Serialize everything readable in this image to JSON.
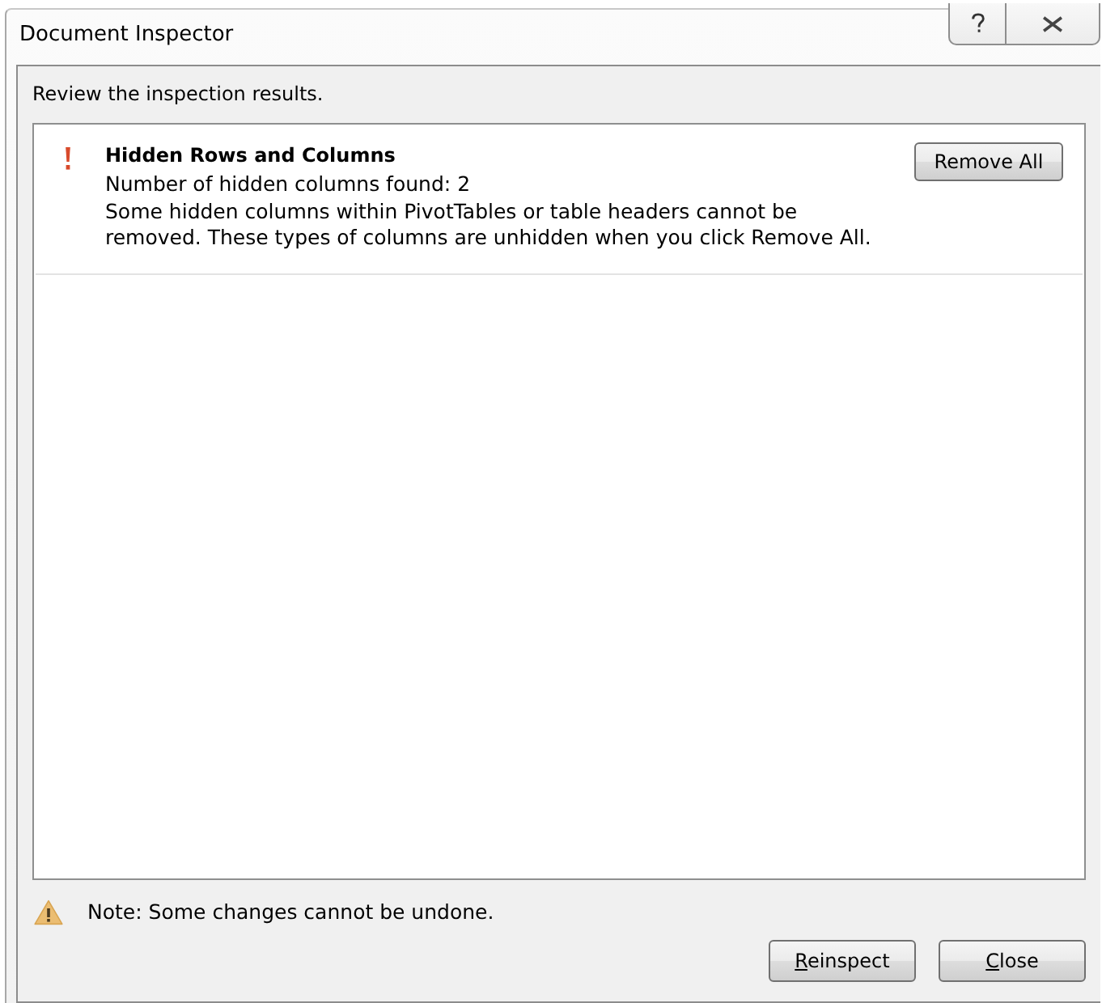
{
  "window": {
    "title": "Document Inspector"
  },
  "title_bar_buttons": [
    {
      "kind": "help"
    },
    {
      "kind": "close"
    }
  ],
  "instruction": "Review the inspection results.",
  "results": [
    {
      "kind": "issue",
      "title": "Hidden Rows and Columns",
      "description": [
        "Number of hidden columns found: 2",
        "Some hidden columns within PivotTables or table headers cannot be removed. These types of columns are unhidden when you click Remove All."
      ],
      "action": "Remove All"
    }
  ],
  "note": {
    "kind": "warning",
    "text": "Note: Some changes cannot be undone."
  },
  "buttons": [
    "Reinspect",
    "Close"
  ]
}
